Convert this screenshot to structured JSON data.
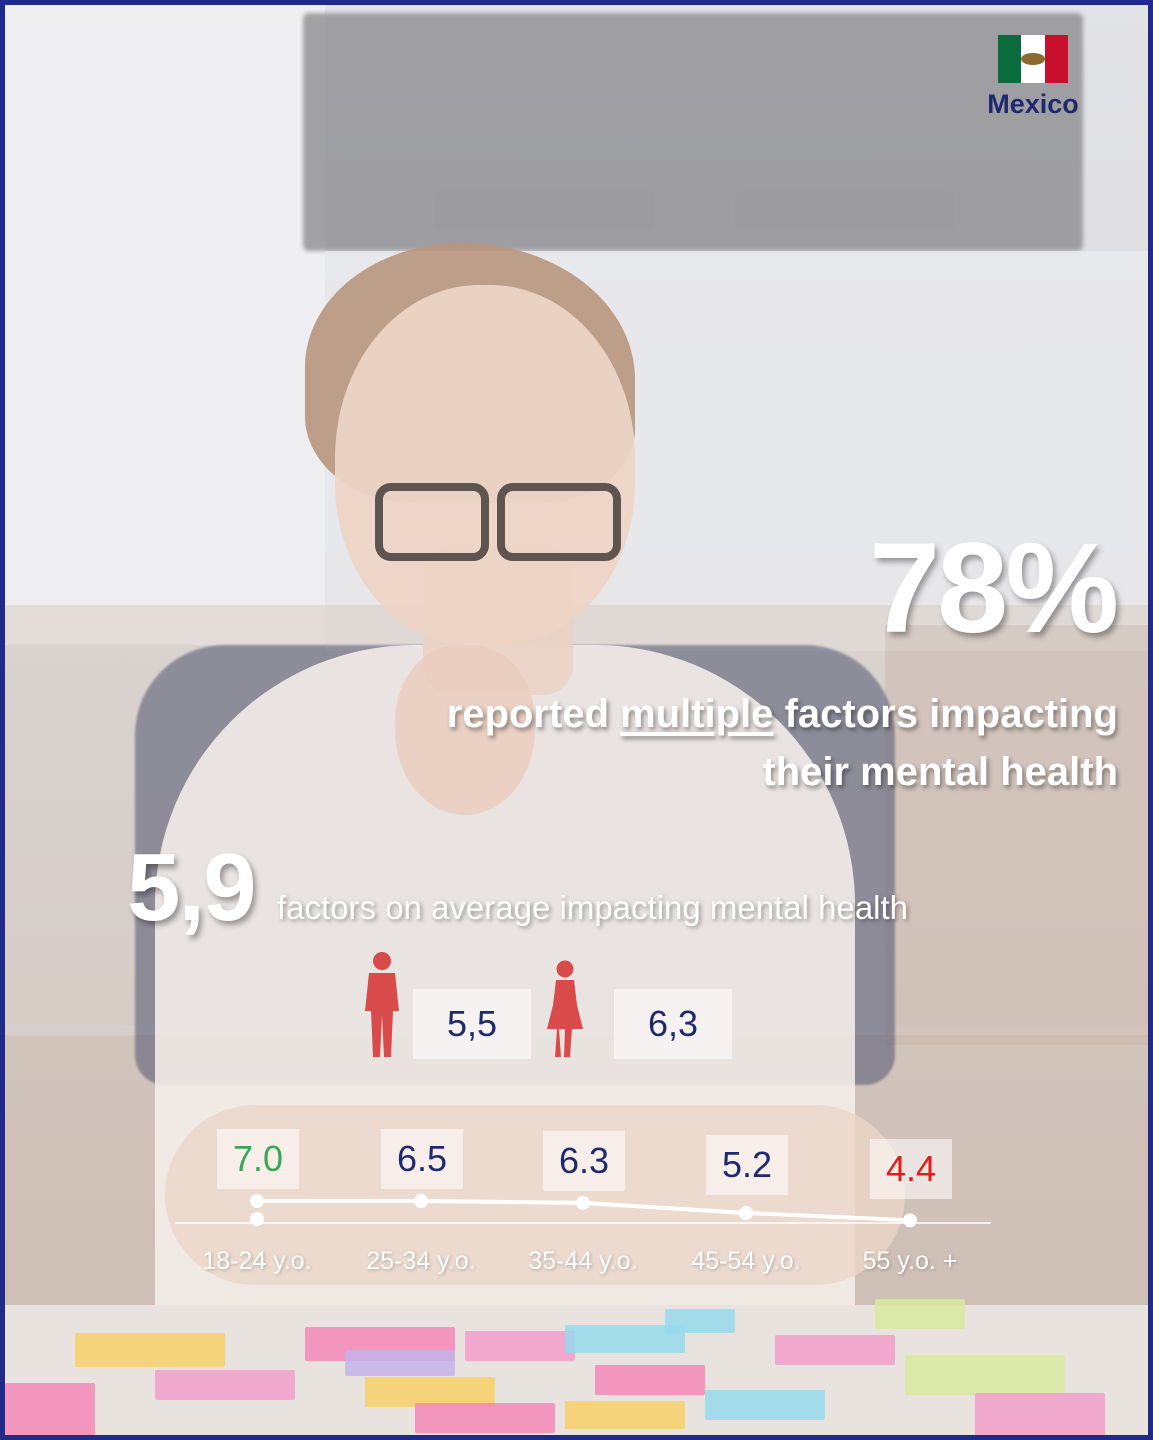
{
  "country": {
    "name": "Mexico",
    "flag_icon": "mexico-flag-icon"
  },
  "headline": {
    "percent": "78%",
    "text_before": "reported",
    "text_underlined": "multiple",
    "text_after_line1": "factors impacting",
    "text_line2": "their mental health"
  },
  "average": {
    "value": "5,9",
    "label": "factors on average impacting mental health"
  },
  "gender": [
    {
      "icon": "male-figure-icon",
      "value": "5,5"
    },
    {
      "icon": "female-figure-icon",
      "value": "6,3"
    }
  ],
  "colors": {
    "navy": "#1f2a6e",
    "green": "#3aa65a",
    "red": "#e41b1b",
    "gender_icon": "#d94a4a",
    "border": "#1f2a8a"
  },
  "chart_data": {
    "type": "line",
    "categories": [
      "18-24 y.o.",
      "25-34 y.o.",
      "35-44 y.o.",
      "45-54 y.o.",
      "55 y.o. +"
    ],
    "values": [
      7.0,
      6.5,
      6.3,
      5.2,
      4.4
    ],
    "labels": [
      "7.0",
      "6.5",
      "6.3",
      "5.2",
      "4.4"
    ],
    "label_colors": [
      "green",
      "navy",
      "navy",
      "navy",
      "red"
    ]
  }
}
